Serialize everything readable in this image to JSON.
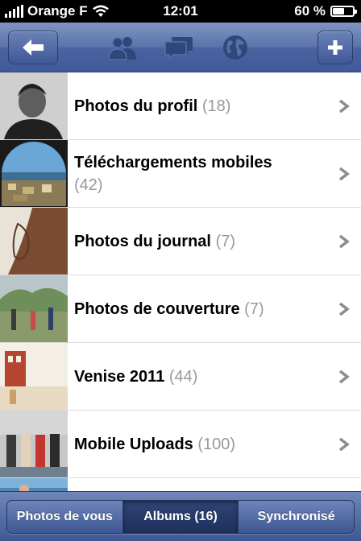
{
  "status_bar": {
    "carrier": "Orange F",
    "time": "12:01",
    "battery_label": "60 %",
    "battery_level": 0.6
  },
  "nav_bar": {
    "back_icon": "back-arrow-icon",
    "icons": [
      "friends-icon",
      "messages-icon",
      "globe-icon"
    ],
    "add_icon": "plus-icon"
  },
  "albums": [
    {
      "title": "Photos du profil",
      "count": "(18)"
    },
    {
      "title": "Téléchargements mobiles",
      "count": "(42)"
    },
    {
      "title": "Photos du journal",
      "count": "(7)"
    },
    {
      "title": "Photos de couverture",
      "count": "(7)"
    },
    {
      "title": "Venise 2011",
      "count": "(44)"
    },
    {
      "title": "Mobile Uploads",
      "count": "(100)"
    }
  ],
  "tab_bar": {
    "tabs": [
      {
        "label": "Photos de vous",
        "active": false
      },
      {
        "label": "Albums (16)",
        "active": true
      },
      {
        "label": "Synchronisé",
        "active": false
      }
    ]
  },
  "colors": {
    "nav_blue": "#4b649f",
    "count_gray": "#999999",
    "chevron_gray": "#8c8c8c"
  }
}
